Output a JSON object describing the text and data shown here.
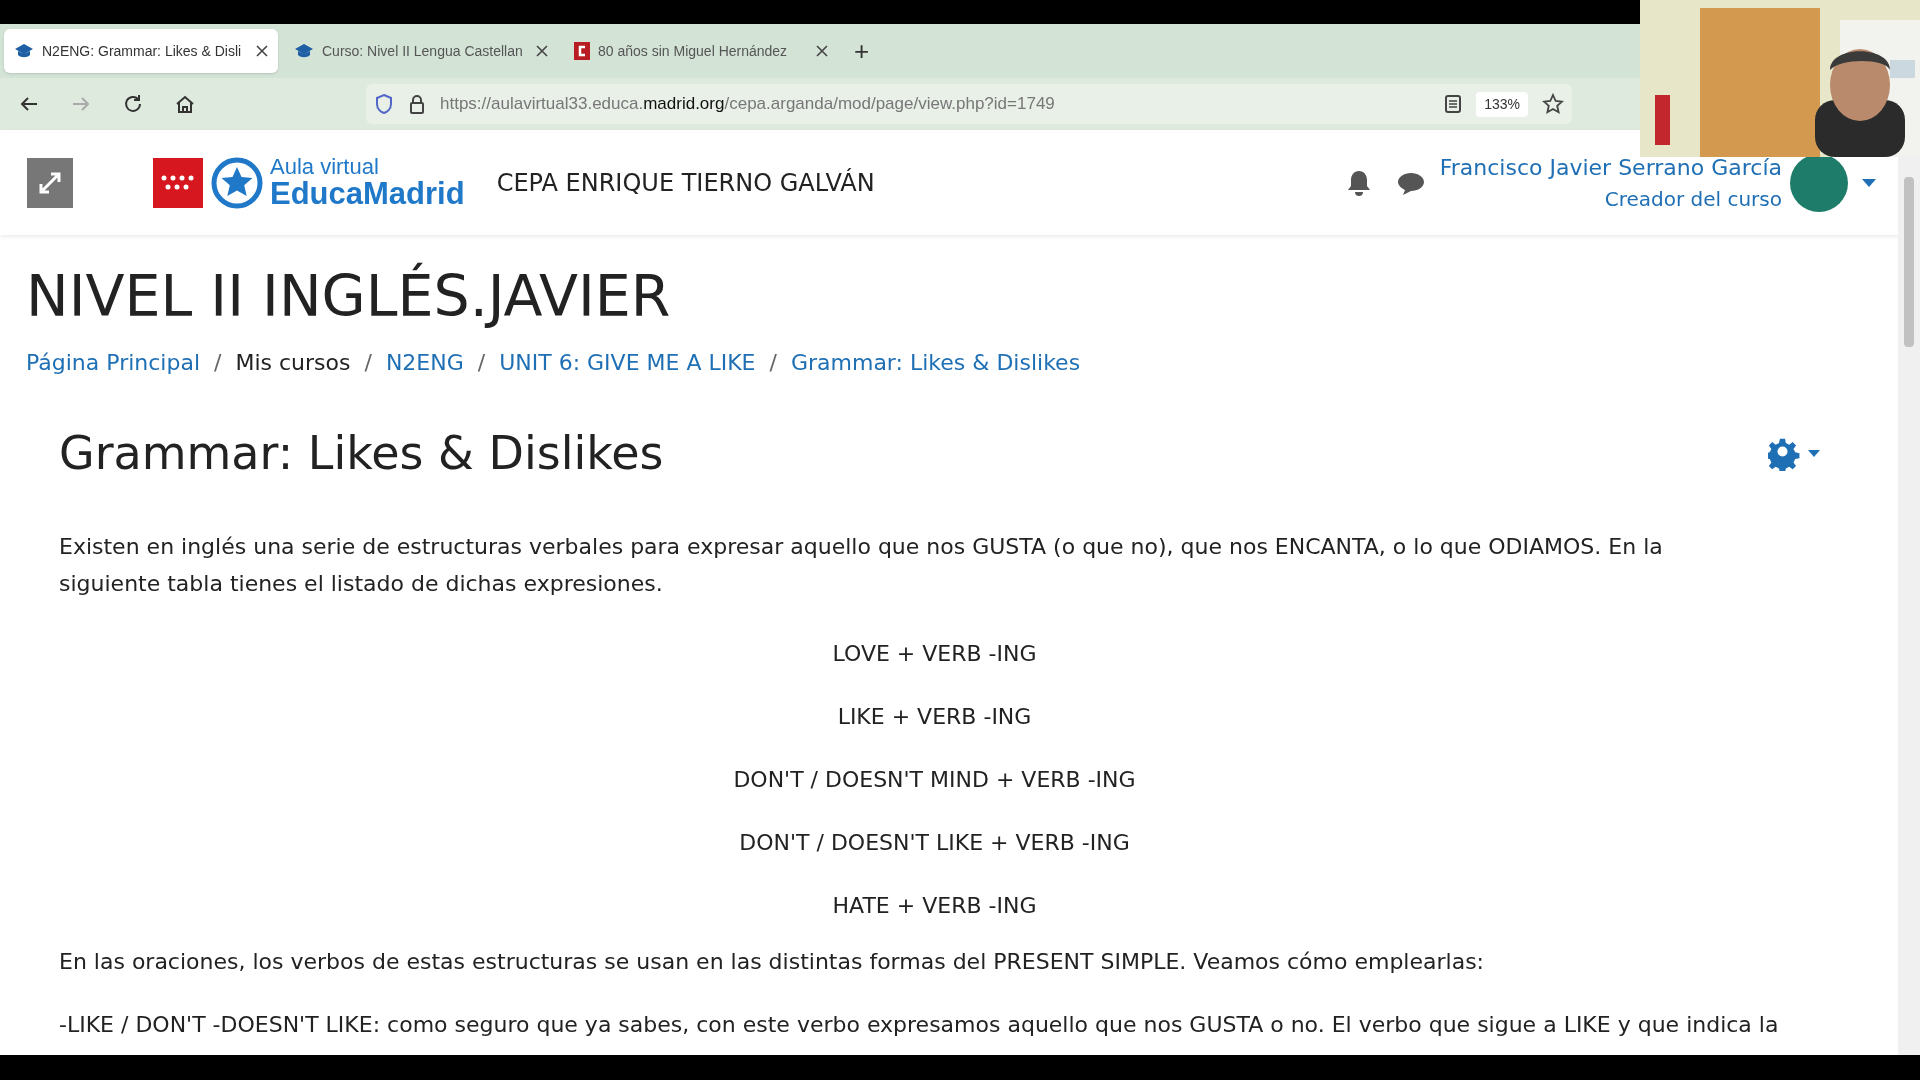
{
  "browser": {
    "tabs": [
      {
        "title": "N2ENG: Grammar: Likes & Disli",
        "selected": true,
        "kind": "course"
      },
      {
        "title": "Curso: Nivel II Lengua Castellan",
        "selected": false,
        "kind": "course"
      },
      {
        "title": "80 años sin Miguel Hernández",
        "selected": false,
        "kind": "site"
      }
    ],
    "new_tab": "+",
    "url_before": "https://aulavirtual33.educa.",
    "url_domain": "madrid.org",
    "url_after": "/cepa.arganda/mod/page/view.php?id=1749",
    "zoom": "133%"
  },
  "webcam": {
    "kind": "picture"
  },
  "header": {
    "logo_top": "Aula virtual",
    "logo_bottom": "EducaMadrid",
    "site_name": "CEPA ENRIQUE TIERNO GALVÁN",
    "user_name": "Francisco Javier Serrano García",
    "user_role": "Creador del curso"
  },
  "page_title": "NIVEL II INGLÉS.JAVIER",
  "breadcrumb": [
    {
      "label": "Página Principal",
      "link": true
    },
    {
      "separator": "/",
      "label": "Mis cursos",
      "link": false
    },
    {
      "separator": "/",
      "label": "N2ENG",
      "link": true
    },
    {
      "separator": "/",
      "label": "UNIT 6: GIVE ME A LIKE",
      "link": true
    },
    {
      "separator": "/",
      "label": "Grammar: Likes & Dislikes",
      "link": true
    }
  ],
  "heading": "Grammar: Likes & Dislikes",
  "intro": "Existen en inglés una serie de estructuras verbales para expresar aquello que nos GUSTA (o que no), que nos ENCANTA, o lo que ODIAMOS. En la siguiente tabla tienes el listado de dichas expresiones.",
  "structures": [
    "LOVE + VERB -ING",
    "LIKE + VERB -ING",
    "DON'T / DOESN'T MIND + VERB -ING",
    "DON'T / DOESN'T LIKE + VERB -ING",
    "HATE + VERB -ING"
  ],
  "paragraphs": [
    "En las oraciones, los verbos de estas estructuras se usan en las distintas formas del PRESENT SIMPLE. Veamos cómo emplearlas:",
    "-LIKE / DON'T -DOESN'T LIKE: como seguro que ya sabes, con este verbo expresamos aquello que nos GUSTA o no. El verbo que sigue a LIKE y que indica la"
  ]
}
